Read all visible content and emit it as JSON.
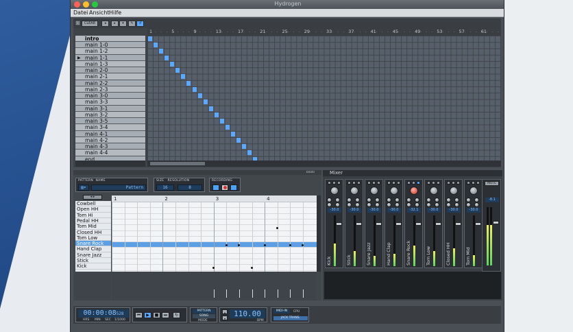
{
  "window": {
    "title": "Hydrogen"
  },
  "menu": [
    "Datei",
    "Ansicht",
    "Hilfe"
  ],
  "song_editor": {
    "toolbar": {
      "clear_label": "CLEAR"
    },
    "ruler_ticks": [
      "1",
      "5",
      "9",
      "13",
      "17",
      "21",
      "25",
      "29",
      "33",
      "37",
      "41",
      "45",
      "49",
      "53",
      "57",
      "61"
    ],
    "patterns": [
      "intro",
      "main 1-0",
      "main 1-2",
      "main 1-1",
      "main 1-3",
      "main 2-0",
      "main 2-1",
      "main 2-2",
      "main 2-3",
      "main 3-0",
      "main 3-3",
      "main 3-1",
      "main 3-2",
      "main 3-5",
      "main 3-4",
      "main 4-1",
      "main 4-2",
      "main 4-3",
      "main 4-4",
      "end"
    ],
    "selected_pattern": "main 1-1",
    "active_cells_note": "diagonal: pattern N placed at bar N"
  },
  "pattern_editor": {
    "pattern_label": "PATTERN",
    "name_label": "NAME",
    "pattern_name": "Pattern",
    "size_label": "SIZE",
    "size_value": "16",
    "resolution_label": "RESOLUTION",
    "resolution_value": "8",
    "recording_label": "RECORDING",
    "ruler": [
      "1",
      "2",
      "3",
      "4"
    ],
    "instruments": [
      "Cowbell",
      "Open HH",
      "Tom Hi",
      "Pedal HH",
      "Tom Mid",
      "Closed HH",
      "Tom Low",
      "Snare Rock",
      "Hand Clap",
      "Snare Jazz",
      "Stick",
      "Kick"
    ],
    "highlighted_instrument": "Snare Rock"
  },
  "mixer": {
    "title": "Mixer",
    "channels": [
      {
        "name": "Kick",
        "value": "-30.0",
        "level": 0.45
      },
      {
        "name": "Stick",
        "value": "-30.0",
        "level": 0.3
      },
      {
        "name": "Snare Jazz",
        "value": "-30.0",
        "level": 0.2
      },
      {
        "name": "Hand Clap",
        "value": "-30.0",
        "level": 0.25
      },
      {
        "name": "Snare Rock",
        "value": "-32.1",
        "level": 0.4
      },
      {
        "name": "Tom Low",
        "value": "-30.0",
        "level": 0.3
      },
      {
        "name": "Closed HH",
        "value": "-30.0",
        "level": 0.35
      },
      {
        "name": "Tom Mid",
        "value": "-30.0",
        "level": 0.22
      }
    ],
    "master_button": "MUTE",
    "master_value": "-8.1"
  },
  "transport": {
    "time": "00:00:08",
    "time_fraction": "528",
    "time_labels": [
      "HRS",
      "MIN",
      "SEC",
      "1/1000"
    ],
    "mode_pattern": "PATTERN",
    "mode_song": "SONG",
    "mode_label": "MODE",
    "bpm": "110.00",
    "bpm_label": "BPM",
    "midi_label": "MIDI-IN",
    "cpu_label": "CPU",
    "jack_label": "JACK TRANS."
  },
  "colors": {
    "accent": "#5aa8ff",
    "highlight_row": "#5d9fe5"
  }
}
